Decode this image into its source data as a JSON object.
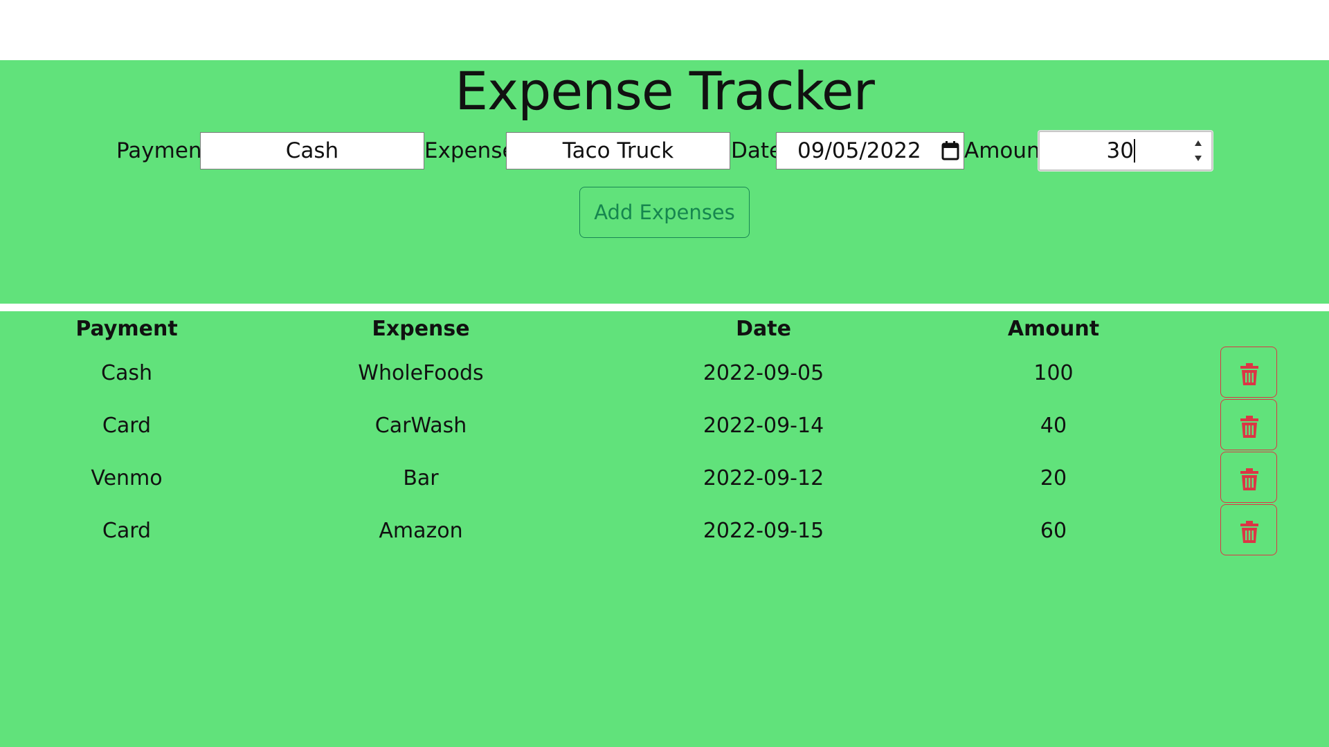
{
  "header": {
    "title": "Expense Tracker"
  },
  "form": {
    "payment_label": "Payment",
    "payment_value": "Cash",
    "expense_label": "Expense",
    "expense_value": "Taco Truck",
    "date_label": "Date",
    "date_value": "09/05/2022",
    "amount_label": "Amount",
    "amount_value": "30",
    "add_button_label": "Add Expenses"
  },
  "table": {
    "columns": [
      "Payment",
      "Expense",
      "Date",
      "Amount"
    ],
    "rows": [
      {
        "payment": "Cash",
        "expense": "WholeFoods",
        "date": "2022-09-05",
        "amount": "100"
      },
      {
        "payment": "Card",
        "expense": "CarWash",
        "date": "2022-09-14",
        "amount": "40"
      },
      {
        "payment": "Venmo",
        "expense": "Bar",
        "date": "2022-09-12",
        "amount": "20"
      },
      {
        "payment": "Card",
        "expense": "Amazon",
        "date": "2022-09-15",
        "amount": "60"
      }
    ],
    "row_action_icon": "trash-icon"
  },
  "colors": {
    "background": "#61e27b",
    "add_button_accent": "#198754",
    "delete_button_accent": "#dc3545"
  }
}
